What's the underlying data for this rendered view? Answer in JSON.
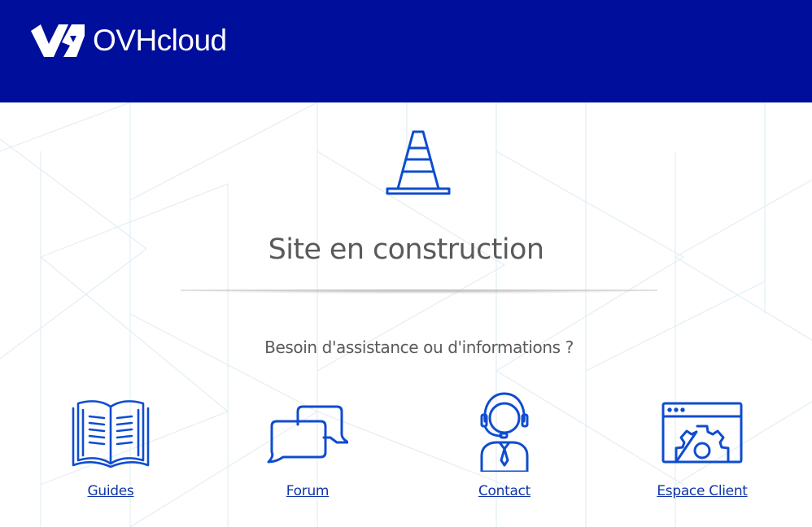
{
  "header": {
    "brand_name": "OVHcloud",
    "background_color": "#000e9c",
    "logo_icon": "ovh-logo-icon"
  },
  "main": {
    "icon": "traffic-cone-icon",
    "title": "Site en construction",
    "subtitle": "Besoin d'assistance ou d'informations ?",
    "accent_color": "#0f4ccf"
  },
  "links": [
    {
      "label": "Guides",
      "icon": "book-icon"
    },
    {
      "label": "Forum",
      "icon": "chat-bubbles-icon"
    },
    {
      "label": "Contact",
      "icon": "support-agent-icon"
    },
    {
      "label": "Espace Client",
      "icon": "settings-window-icon"
    }
  ]
}
